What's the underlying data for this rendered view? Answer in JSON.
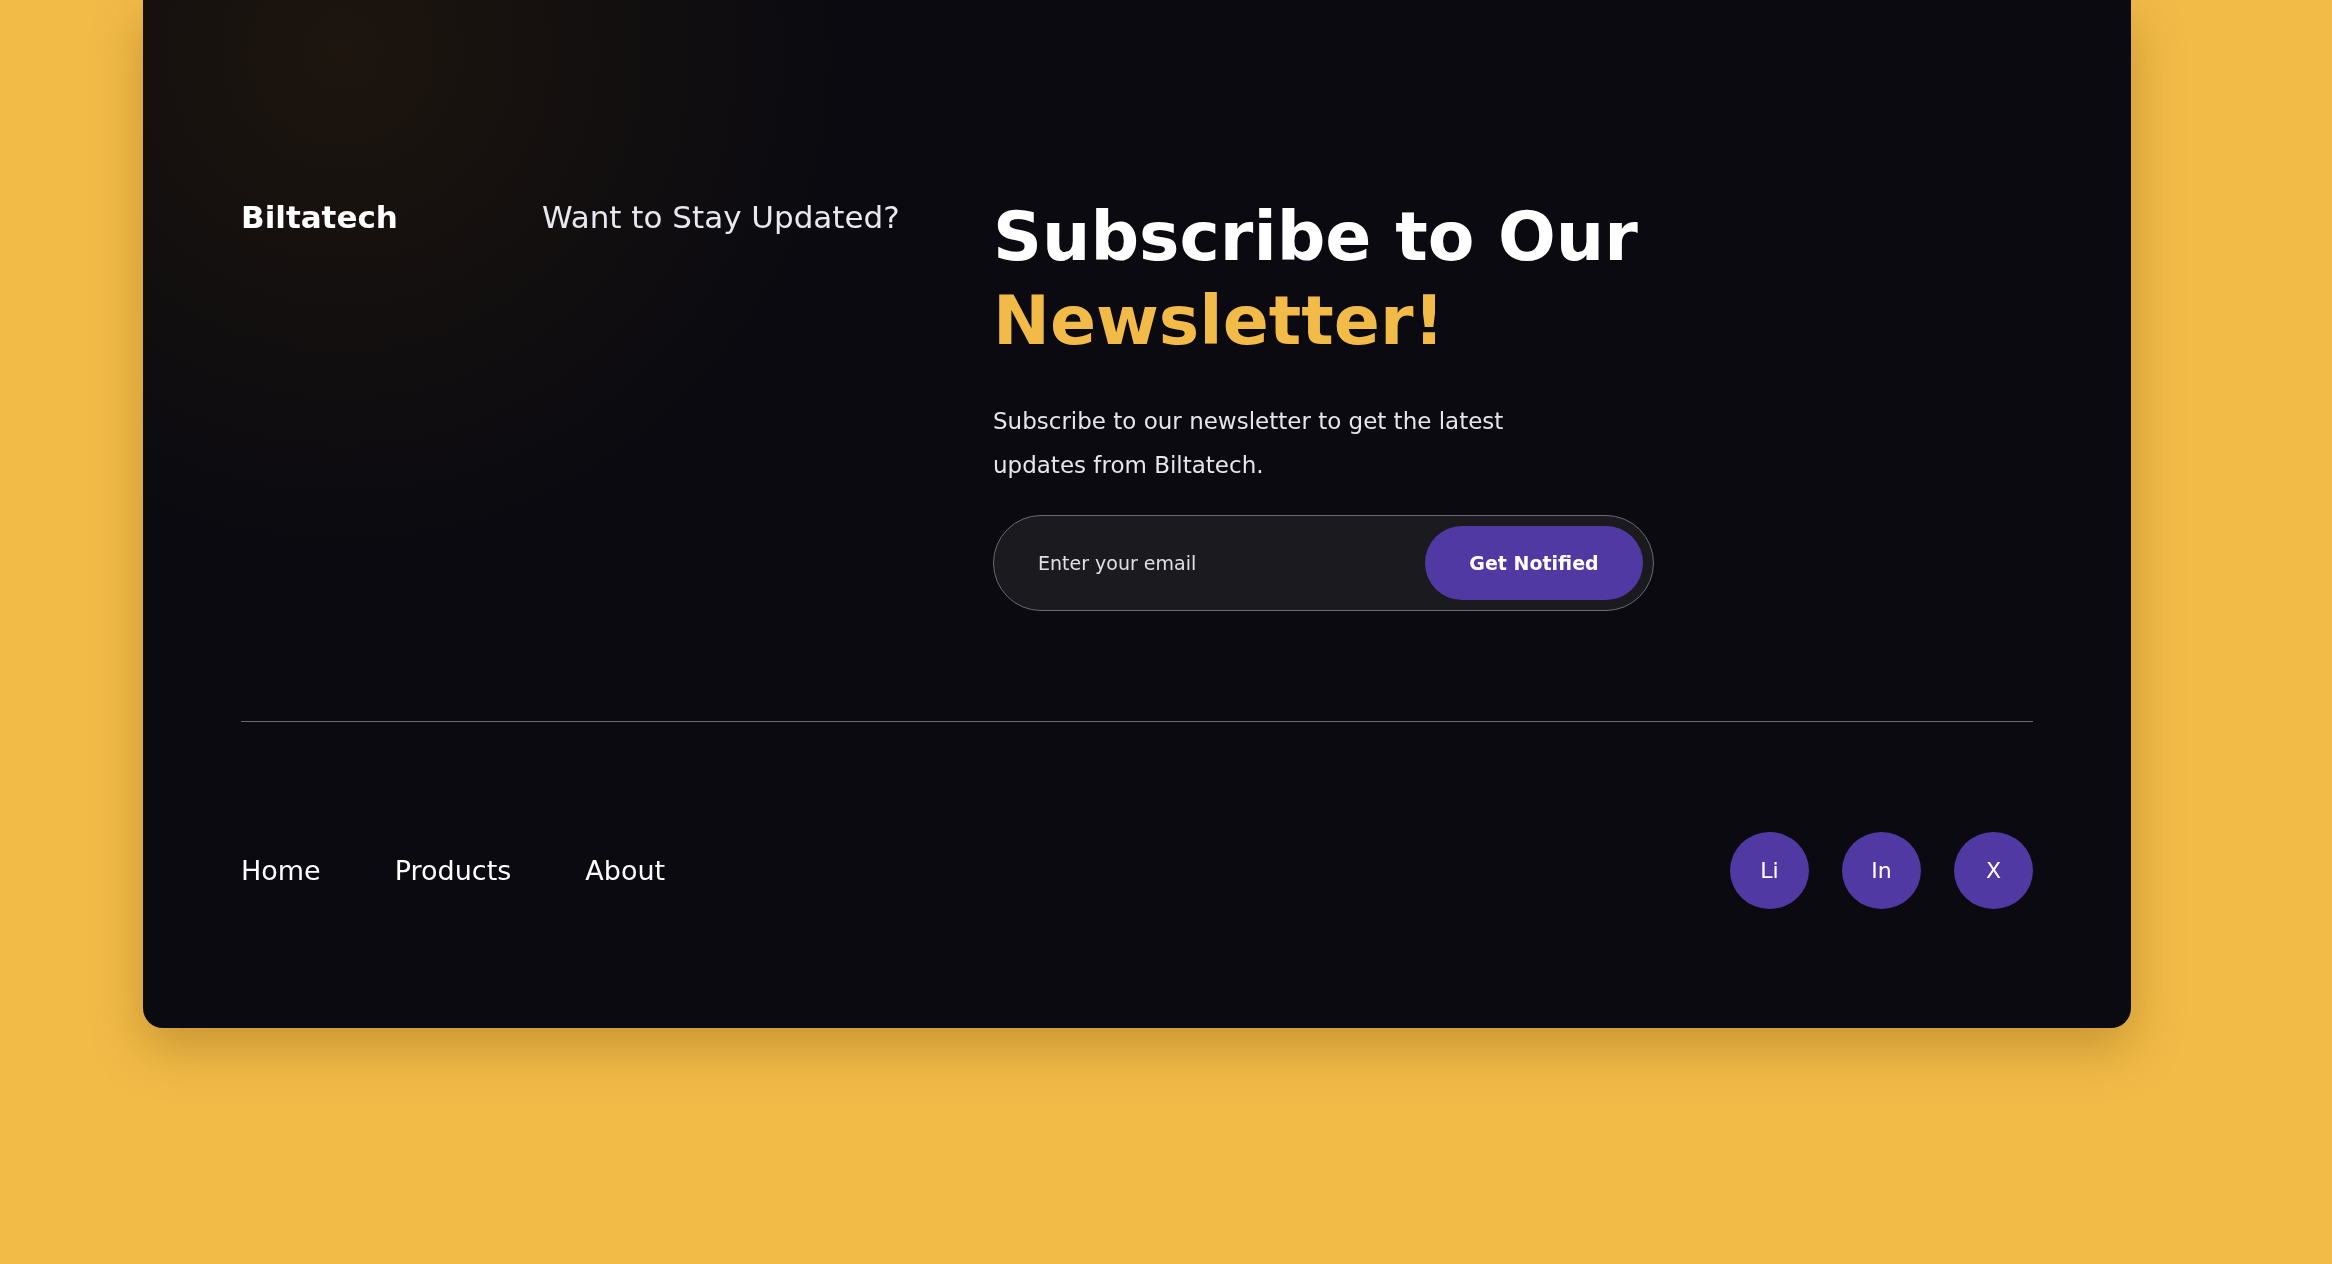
{
  "brand": "Biltatech",
  "tagline": "Want to Stay Updated?",
  "heading": {
    "line_1": "Subscribe to Our",
    "line_2": "Newsletter!"
  },
  "description": "Subscribe to our newsletter to get the latest updates from Biltatech.",
  "form": {
    "placeholder": "Enter your email",
    "button": "Get Notified"
  },
  "nav": [
    "Home",
    "Products",
    "About"
  ],
  "social": [
    "Li",
    "In",
    "X"
  ]
}
